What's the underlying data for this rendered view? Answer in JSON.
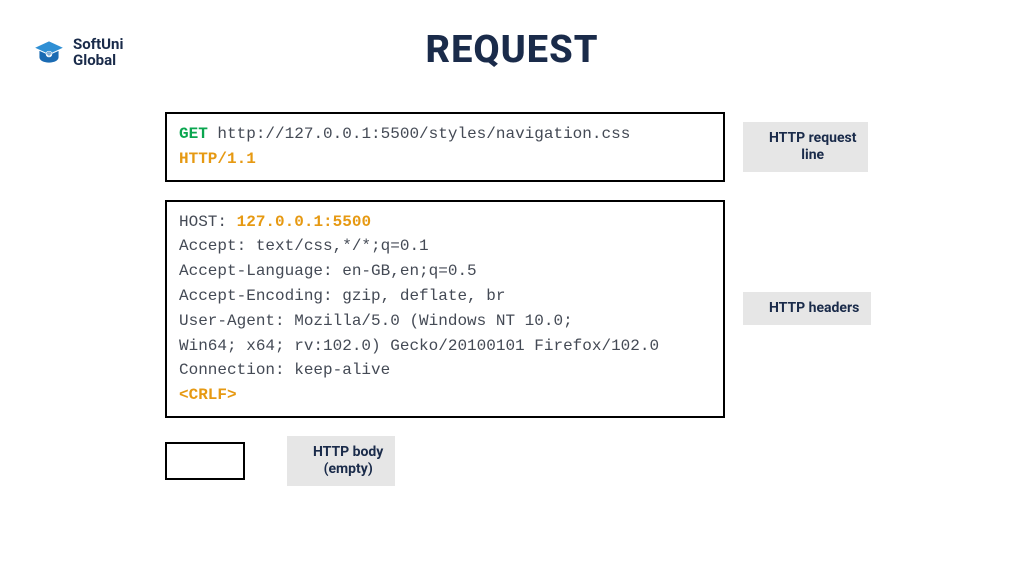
{
  "logo": {
    "line1": "SoftUni",
    "line2": "Global"
  },
  "title": "REQUEST",
  "requestLine": {
    "method": "GET",
    "url": "http://127.0.0.1:5500/styles/navigation.css",
    "protocol": "HTTP/1.1",
    "label": "HTTP request\nline"
  },
  "headers": {
    "hostKey": "HOST:",
    "hostValue": "127.0.0.1:5500",
    "lines": [
      "Accept: text/css,*/*;q=0.1",
      "Accept-Language: en-GB,en;q=0.5",
      "Accept-Encoding: gzip, deflate, br",
      "User-Agent: Mozilla/5.0 (Windows NT 10.0;",
      "Win64; x64; rv:102.0) Gecko/20100101 Firefox/102.0",
      "Connection: keep-alive"
    ],
    "crlf": "<CRLF>",
    "label": "HTTP headers"
  },
  "body": {
    "label": "HTTP body\n(empty)"
  },
  "colors": {
    "green": "#0aa64f",
    "orange": "#e69912",
    "dark": "#1a2b4a",
    "grey": "#e6e6e6"
  }
}
